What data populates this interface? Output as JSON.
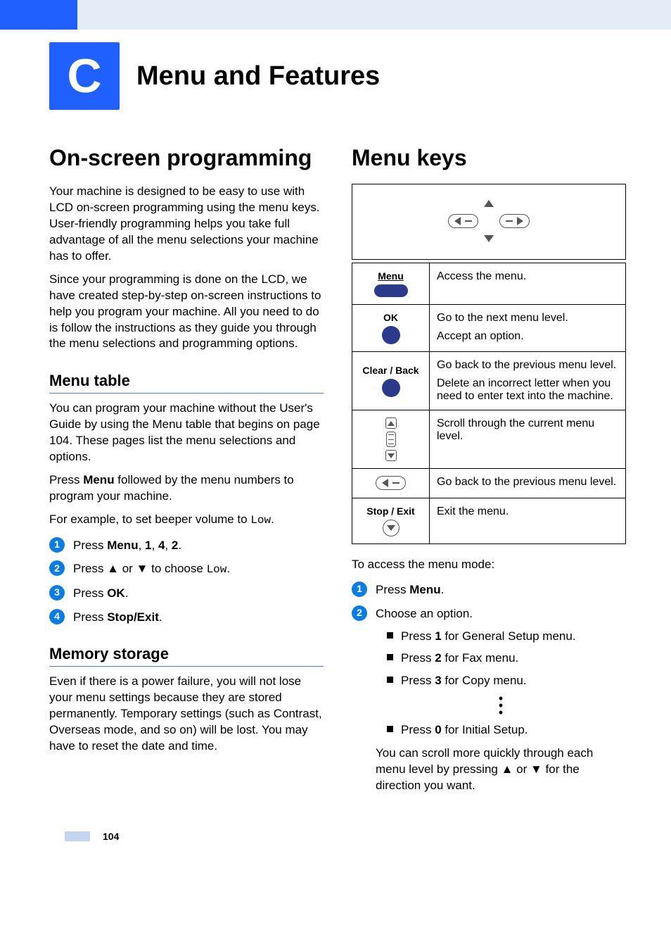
{
  "chapter": {
    "letter": "C",
    "title": "Menu and Features"
  },
  "left": {
    "h1": "On-screen programming",
    "p1": "Your machine is designed to be easy to use with LCD on-screen programming using the menu keys. User-friendly programming helps you take full advantage of all the menu selections your machine has to offer.",
    "p2": "Since your programming is done on the LCD, we have created step-by-step on-screen instructions to help you program your machine. All you need to do is follow the instructions as they guide you through the menu selections and programming options.",
    "sub1": "Menu table",
    "p3": "You can program your machine without the User's Guide by using the Menu table that begins on page 104. These pages list the menu selections and options.",
    "p4_pre": "Press ",
    "p4_b": "Menu",
    "p4_post": " followed by the menu numbers to program your machine.",
    "p5_pre": "For example, to set beeper volume to ",
    "p5_mono": "Low",
    "p5_post": ".",
    "steps": [
      {
        "pre": "Press ",
        "b1": "Menu",
        "mid": ", ",
        "b2": "1",
        "mid2": ", ",
        "b3": "4",
        "mid3": ", ",
        "b4": "2",
        "post": "."
      },
      {
        "pre": "Press ▲ or ▼ to choose ",
        "mono": "Low",
        "post": "."
      },
      {
        "pre": "Press ",
        "b1": "OK",
        "post": "."
      },
      {
        "pre": "Press ",
        "b1": "Stop/Exit",
        "post": "."
      }
    ],
    "sub2": "Memory storage",
    "p6": "Even if there is a power failure, you will not lose your menu settings because they are stored permanently. Temporary settings (such as Contrast, Overseas mode, and so on) will be lost. You may have to reset the date and time."
  },
  "right": {
    "h1": "Menu keys",
    "table": [
      {
        "label": "Menu",
        "desc": "Access the menu."
      },
      {
        "label": "OK",
        "desc1": "Go to the next menu level.",
        "desc2": "Accept an option."
      },
      {
        "label": "Clear / Back",
        "desc1": "Go back to the previous menu level.",
        "desc2": "Delete an incorrect letter when you need to enter text into the machine."
      },
      {
        "desc": "Scroll through the current menu level."
      },
      {
        "desc": "Go back to the previous menu level."
      },
      {
        "label": "Stop / Exit",
        "desc": "Exit the menu."
      }
    ],
    "access_intro": "To access the menu mode:",
    "step1_pre": "Press ",
    "step1_b": "Menu",
    "step1_post": ".",
    "step2": "Choose an option.",
    "opts": [
      {
        "pre": "Press ",
        "b": "1",
        "post": " for General Setup menu."
      },
      {
        "pre": "Press ",
        "b": "2",
        "post": " for Fax menu."
      },
      {
        "pre": "Press ",
        "b": "3",
        "post": " for Copy menu."
      }
    ],
    "opt_last": {
      "pre": "Press ",
      "b": "0",
      "post": " for Initial Setup."
    },
    "p_scroll": "You can scroll more quickly through each menu level by pressing ▲ or ▼ for the direction you want."
  },
  "page_number": "104"
}
